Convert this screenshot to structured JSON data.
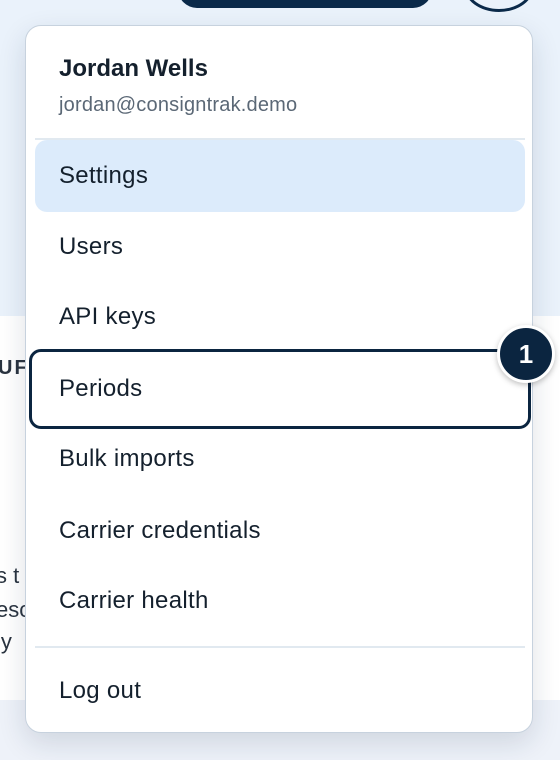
{
  "background": {
    "section_label": "UF",
    "text_lines": [
      "s t",
      "esc",
      "ly"
    ]
  },
  "menu": {
    "user": {
      "name": "Jordan Wells",
      "email": "jordan@consigntrak.demo"
    },
    "items": [
      {
        "label": "Settings",
        "state": "hover"
      },
      {
        "label": "Users"
      },
      {
        "label": "API keys"
      },
      {
        "label": "Periods",
        "state": "focused"
      },
      {
        "label": "Bulk imports"
      },
      {
        "label": "Carrier credentials"
      },
      {
        "label": "Carrier health"
      }
    ],
    "logout_label": "Log out"
  },
  "annotation": {
    "badge_number": "1"
  },
  "colors": {
    "accent_dark": "#0b2540",
    "hover_bg": "#dcebfb",
    "page_bg": "#eaf2fb"
  }
}
